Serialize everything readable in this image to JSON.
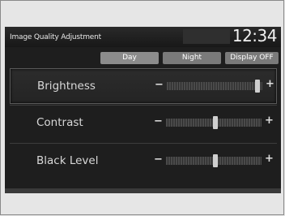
{
  "header": {
    "title": "Image Quality Adjustment",
    "clock": "12:34"
  },
  "tabs": [
    {
      "label": "Day",
      "active": true
    },
    {
      "label": "Night",
      "active": false
    },
    {
      "label": "Display OFF",
      "active": false
    }
  ],
  "settings": [
    {
      "label": "Brightness",
      "minus": "−",
      "plus": "+",
      "level": 0.97,
      "selected": true
    },
    {
      "label": "Contrast",
      "minus": "−",
      "plus": "+",
      "level": 0.52,
      "selected": false
    },
    {
      "label": "Black Level",
      "minus": "−",
      "plus": "+",
      "level": 0.52,
      "selected": false
    }
  ]
}
